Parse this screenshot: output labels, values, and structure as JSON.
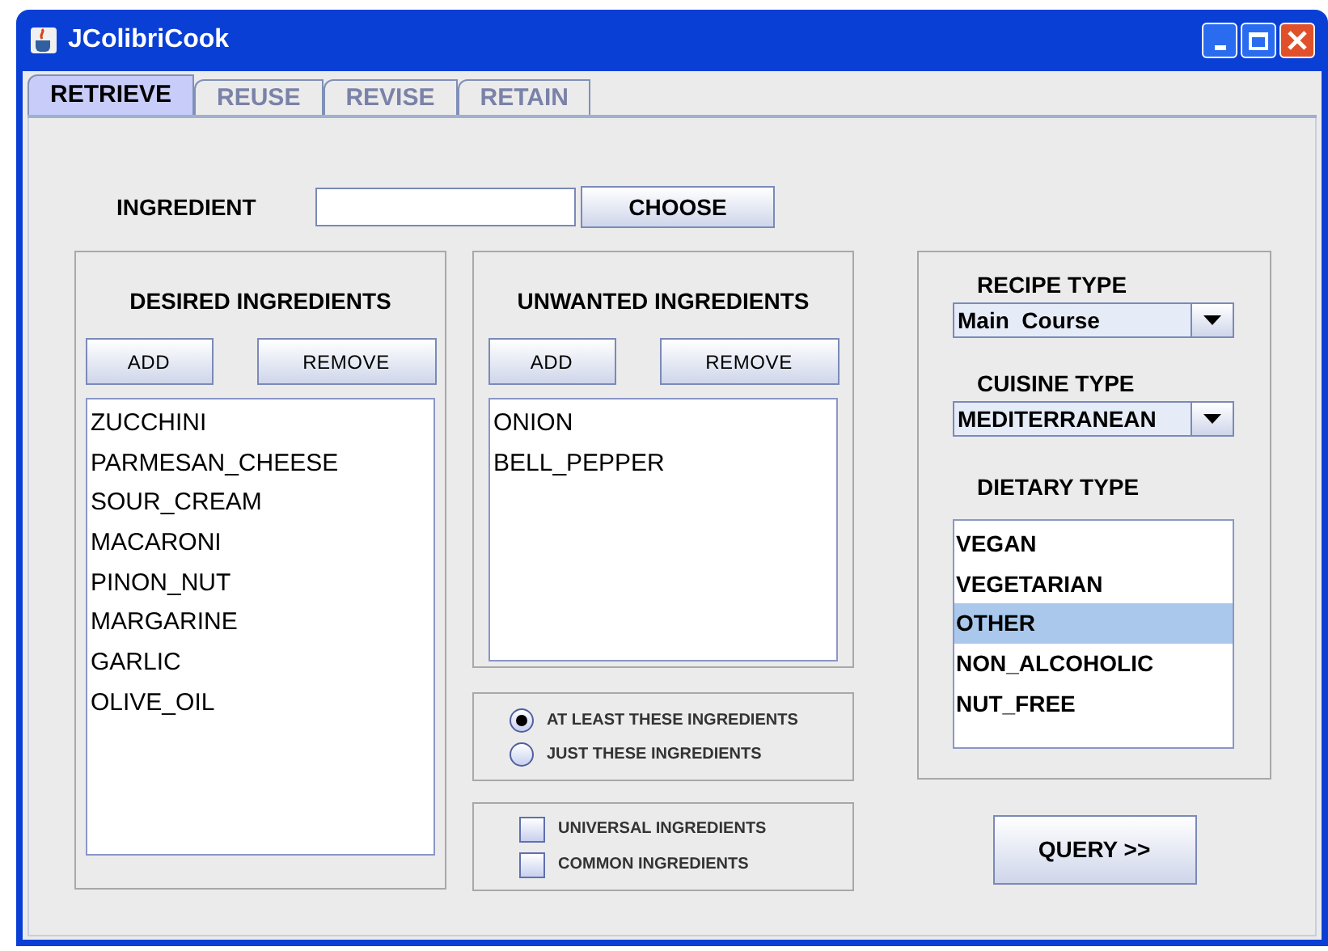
{
  "window": {
    "title": "JColibriCook"
  },
  "tabs": [
    {
      "label": "RETRIEVE",
      "selected": true
    },
    {
      "label": "REUSE",
      "selected": false
    },
    {
      "label": "REVISE",
      "selected": false
    },
    {
      "label": "RETAIN",
      "selected": false
    }
  ],
  "ingredient": {
    "label": "INGREDIENT",
    "button": "CHOOSE"
  },
  "desired": {
    "title": "DESIRED INGREDIENTS",
    "buttons": [
      "ADD",
      "REMOVE"
    ],
    "items": [
      "ZUCCHINI",
      "PARMESAN_CHEESE",
      "SOUR_CREAM",
      "MACARONI",
      "PINON_NUT",
      "MARGARINE",
      "GARLIC",
      "OLIVE_OIL"
    ]
  },
  "unwanted": {
    "title": "UNWANTED INGREDIENTS",
    "buttons": [
      "ADD",
      "REMOVE"
    ],
    "items": [
      "ONION",
      "BELL_PEPPER"
    ]
  },
  "match_mode": [
    {
      "label": "AT LEAST THESE INGREDIENTS",
      "selected": true
    },
    {
      "label": "JUST THESE INGREDIENTS",
      "selected": false
    }
  ],
  "options": [
    {
      "label": "UNIVERSAL INGREDIENTS",
      "checked": false
    },
    {
      "label": "COMMON INGREDIENTS",
      "checked": false
    }
  ],
  "recipe_type": {
    "label": "RECIPE TYPE",
    "value": "Main  Course"
  },
  "cuisine_type": {
    "label": "CUISINE TYPE",
    "value": "MEDITERRANEAN"
  },
  "dietary_type": {
    "label": "DIETARY TYPE",
    "items": [
      {
        "label": "VEGAN",
        "selected": false
      },
      {
        "label": "VEGETARIAN",
        "selected": false
      },
      {
        "label": "OTHER",
        "selected": true
      },
      {
        "label": "NON_ALCOHOLIC",
        "selected": false
      },
      {
        "label": "NUT_FREE",
        "selected": false
      }
    ]
  },
  "query_button": "QUERY >>"
}
